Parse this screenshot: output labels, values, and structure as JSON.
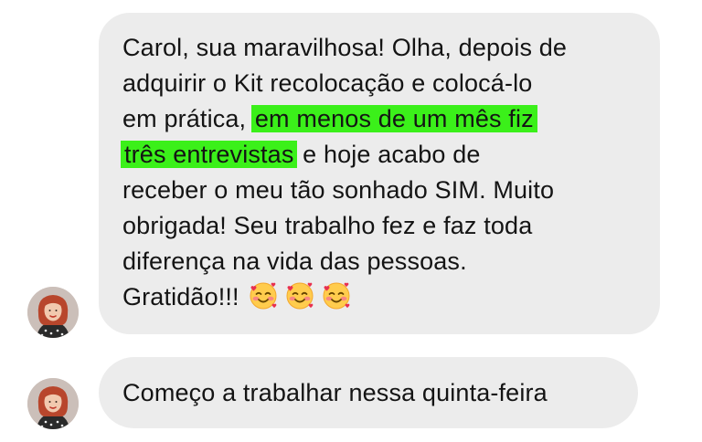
{
  "conversation": {
    "messages": [
      {
        "lines": [
          {
            "before": "Carol, sua maravilhosa! Olha, depois de",
            "highlight": "",
            "after": ""
          },
          {
            "before": "adquirir o Kit recolocação e colocá-lo",
            "highlight": "",
            "after": ""
          },
          {
            "before": "em prática, ",
            "highlight": "em menos de um mês fiz",
            "after": ""
          },
          {
            "before": "",
            "highlight": "três entrevistas",
            "after": " e hoje acabo de"
          },
          {
            "before": "receber o meu tão sonhado SIM. Muito",
            "highlight": "",
            "after": ""
          },
          {
            "before": "obrigada! Seu trabalho fez e faz toda",
            "highlight": "",
            "after": ""
          },
          {
            "before": "diferença na vida das pessoas.",
            "highlight": "",
            "after": ""
          },
          {
            "before": "Gratidão!!!",
            "highlight": "",
            "after": ""
          }
        ],
        "emojis": [
          "smiling-face-with-hearts",
          "smiling-face-with-hearts",
          "smiling-face-with-hearts"
        ]
      },
      {
        "text": "Começo a trabalhar nessa quinta-feira"
      }
    ]
  },
  "colors": {
    "bubble": "#ececec",
    "highlight": "#3bf01a",
    "text": "#141414"
  }
}
